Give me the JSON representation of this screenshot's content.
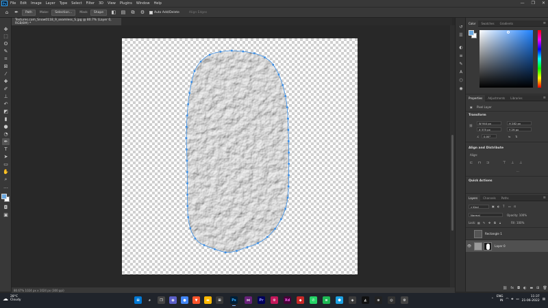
{
  "menubar": {
    "logo": "Ps",
    "items": [
      "File",
      "Edit",
      "Image",
      "Layer",
      "Type",
      "Select",
      "Filter",
      "3D",
      "View",
      "Plugins",
      "Window",
      "Help"
    ]
  },
  "options": {
    "path_mode": "Path",
    "make_label": "Make:",
    "selection_button": "Selection...",
    "mask_button": "Mask",
    "shape_button": "Shape",
    "auto_add_delete": "Auto Add/Delete",
    "align_edges": "Align Edges"
  },
  "document": {
    "tab_title": "Textures.com_Snow0118_9_seamless_S.jpg @ 80.7% (Layer 0, RGB/8#) *",
    "status": "80.67%    1024 px x 1024 px (300 ppi)"
  },
  "panels": {
    "color_tabs": [
      "Color",
      "Swatches",
      "Gradients"
    ],
    "properties_tabs": [
      "Properties",
      "Adjustments",
      "Libraries"
    ],
    "layer_kind": "Pixel Layer",
    "transform_title": "Transform",
    "transform": {
      "w": "W 944 px",
      "h": "H 282 px",
      "x": "X 375 px",
      "y": "Y 29 px",
      "angle": "0.00°"
    },
    "align_title": "Align and Distribute",
    "align_label": "Align:",
    "quick_actions": "Quick Actions",
    "more": "...",
    "layers_tabs": [
      "Layers",
      "Channels",
      "Paths"
    ],
    "kind": "Kind",
    "blend_mode": "Normal",
    "opacity": "Opacity: 100%",
    "lock": "Lock:",
    "fill": "Fill: 100%",
    "layers": [
      {
        "name": "Rectangle 1",
        "selected": false
      },
      {
        "name": "Layer 0",
        "selected": true
      }
    ]
  },
  "taskbar": {
    "temp": "28°C",
    "weather": "Cloudy",
    "lang": "ENG",
    "region": "IN",
    "time": "11:37",
    "date": "21-06-2022"
  }
}
